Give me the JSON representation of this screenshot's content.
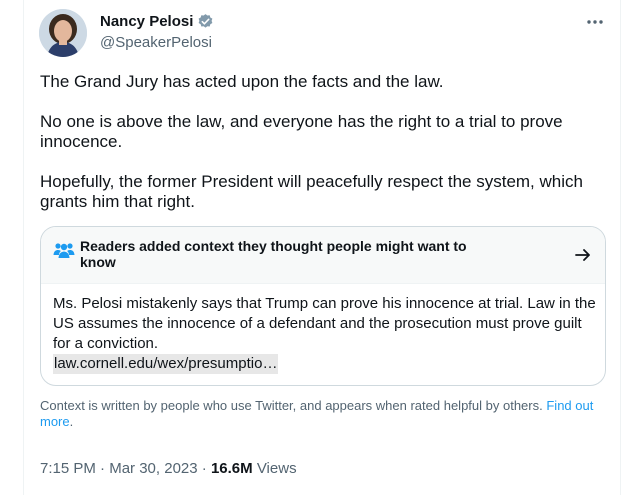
{
  "author": {
    "name": "Nancy Pelosi",
    "handle": "@SpeakerPelosi",
    "verified_icon": "verified-badge-icon",
    "verified_color": "#829aab"
  },
  "tweet": {
    "paragraphs": [
      "The Grand Jury has acted upon the facts and the law.",
      "No one is above the law, and everyone has the right to a trial to prove innocence.",
      "Hopefully, the former President will peacefully respect the system, which grants him that right."
    ]
  },
  "community_note": {
    "title": "Readers added context they thought people might want to know",
    "body": "Ms. Pelosi mistakenly says that Trump can prove his innocence at trial. Law in the US assumes the innocence of a defendant and the prosecution must prove guilt for a conviction.",
    "link": "law.cornell.edu/wex/presumptio…",
    "icon": "people-icon",
    "accent_color": "#1d9bf0"
  },
  "context_notice": {
    "text": "Context is written by people who use Twitter, and appears when rated helpful by others.",
    "link_label": "Find out more",
    "trailing": "."
  },
  "meta": {
    "time": "7:15 PM",
    "date": "Mar 30, 2023",
    "separator": "·",
    "views_count": "16.6M",
    "views_label": "Views"
  }
}
